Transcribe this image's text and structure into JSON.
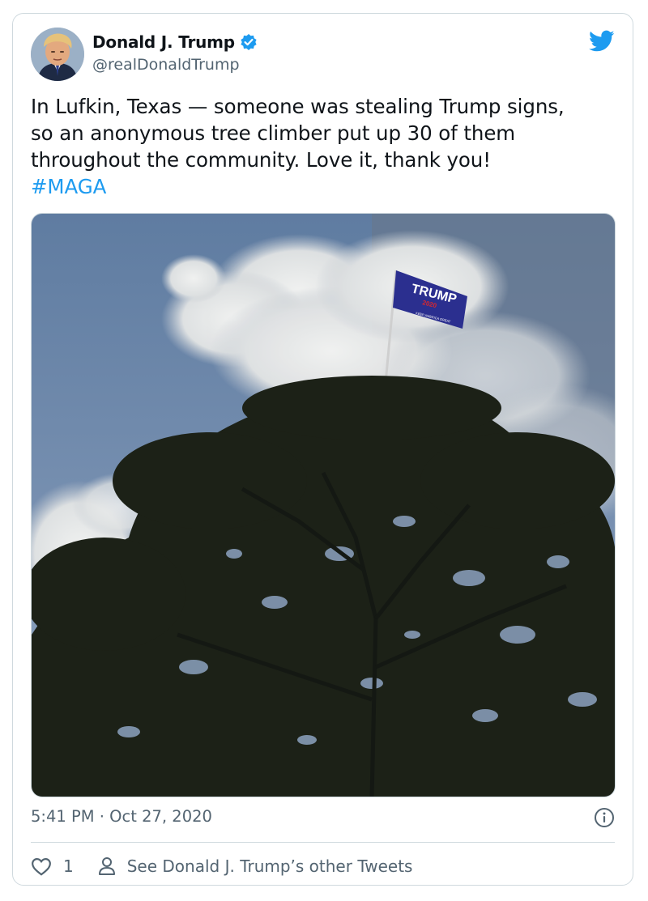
{
  "tweet": {
    "author_name": "Donald J. Trump",
    "author_handle": "@realDonaldTrump",
    "text_lines": [
      "In Lufkin, Texas — someone was stealing Trump signs,",
      "so an anonymous tree climber put up 30 of them",
      "throughout the community. Love it, thank you!"
    ],
    "hashtag": "#MAGA",
    "timestamp": "5:41 PM · Oct 27, 2020",
    "like_count": "1",
    "other_tweets_link": "See Donald J. Trump’s other Tweets"
  },
  "photo": {
    "flag_text": "TRUMP",
    "flag_year": "2020",
    "flag_subtext": "KEEP AMERICA GREAT"
  },
  "icons": {
    "verified": "verified-badge-icon",
    "brand": "twitter-bird-icon",
    "info": "info-icon",
    "like": "heart-icon",
    "profile": "person-icon"
  },
  "colors": {
    "accent": "#1d9bf0",
    "text": "#0f1419",
    "secondary": "#536471",
    "border": "#cfd9de",
    "flag": "#2b2f8f"
  }
}
